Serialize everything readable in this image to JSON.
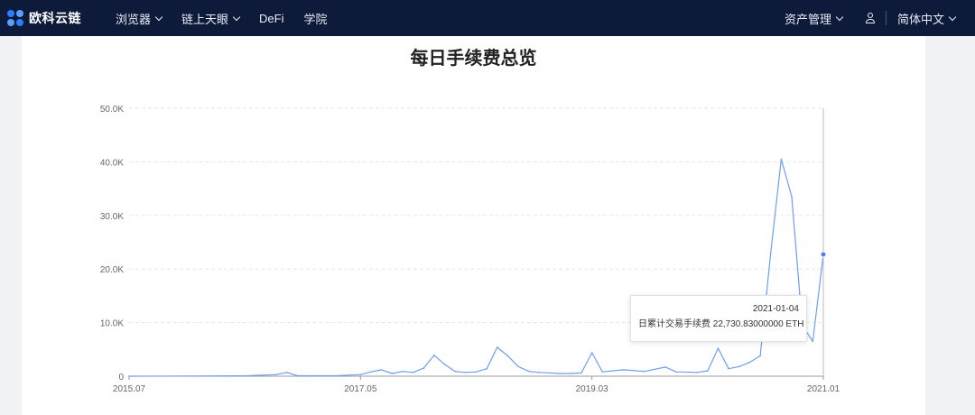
{
  "header": {
    "logo_text": "欧科云链",
    "nav": [
      {
        "label": "浏览器",
        "has_dropdown": true
      },
      {
        "label": "链上天眼",
        "has_dropdown": true
      },
      {
        "label": "DeFi",
        "has_dropdown": false
      },
      {
        "label": "学院",
        "has_dropdown": false
      }
    ],
    "asset_menu": "资产管理",
    "language": "简体中文",
    "icons": [
      "logo-icon",
      "chevron-down-icon",
      "user-icon"
    ]
  },
  "chart_data": {
    "type": "line",
    "title": "每日手续费总览",
    "x_ticks": [
      "2015.07",
      "2017.05",
      "2019.03",
      "2021.01"
    ],
    "y_ticks": [
      "0",
      "10.0K",
      "20.0K",
      "30.0K",
      "40.0K",
      "50.0K"
    ],
    "ylim": [
      0,
      50000
    ],
    "xlim": [
      "2015.07",
      "2021.01"
    ],
    "grid": "horizontal dashed",
    "series": [
      {
        "color": "#6e9ef0",
        "points": [
          [
            "2015.07",
            0
          ],
          [
            "2016.01",
            30
          ],
          [
            "2016.06",
            60
          ],
          [
            "2016.09",
            300
          ],
          [
            "2016.10",
            700
          ],
          [
            "2016.11",
            80
          ],
          [
            "2017.03",
            120
          ],
          [
            "2017.05",
            300
          ],
          [
            "2017.06",
            800
          ],
          [
            "2017.07",
            1200
          ],
          [
            "2017.08",
            500
          ],
          [
            "2017.09",
            900
          ],
          [
            "2017.10",
            700
          ],
          [
            "2017.11",
            1500
          ],
          [
            "2017.12",
            3900
          ],
          [
            "2018.01",
            2200
          ],
          [
            "2018.02",
            900
          ],
          [
            "2018.03",
            700
          ],
          [
            "2018.04",
            800
          ],
          [
            "2018.05",
            1400
          ],
          [
            "2018.06",
            5400
          ],
          [
            "2018.07",
            3800
          ],
          [
            "2018.08",
            1800
          ],
          [
            "2018.09",
            900
          ],
          [
            "2018.10",
            700
          ],
          [
            "2018.12",
            500
          ],
          [
            "2019.01",
            500
          ],
          [
            "2019.02",
            600
          ],
          [
            "2019.03",
            4400
          ],
          [
            "2019.04",
            800
          ],
          [
            "2019.06",
            1200
          ],
          [
            "2019.08",
            900
          ],
          [
            "2019.10",
            1700
          ],
          [
            "2019.11",
            800
          ],
          [
            "2020.01",
            700
          ],
          [
            "2020.02",
            1000
          ],
          [
            "2020.03",
            5200
          ],
          [
            "2020.04",
            1400
          ],
          [
            "2020.05",
            1800
          ],
          [
            "2020.06",
            2600
          ],
          [
            "2020.07",
            3800
          ],
          [
            "2020.08",
            23000
          ],
          [
            "2020.09",
            40500
          ],
          [
            "2020.10",
            33500
          ],
          [
            "2020.11",
            9500
          ],
          [
            "2020.12",
            6500
          ],
          [
            "2021.01",
            22730.83
          ]
        ]
      }
    ],
    "highlight": {
      "x": "2021.01",
      "y": 22730.83
    }
  },
  "tooltip": {
    "date": "2021-01-04",
    "label": "日累计交易手续费",
    "value": "22,730.83000000 ETH"
  }
}
